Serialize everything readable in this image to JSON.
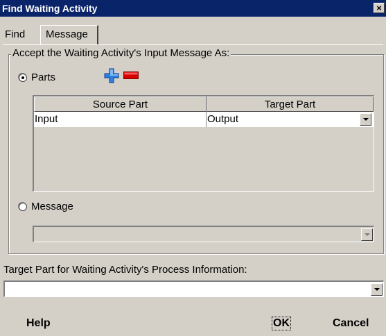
{
  "window": {
    "title": "Find Waiting Activity",
    "close_glyph": "×"
  },
  "tabs": [
    {
      "label": "Find",
      "active": false
    },
    {
      "label": "Message",
      "active": true
    }
  ],
  "accept_group": {
    "legend": "Accept the Waiting Activity's Input Message As:",
    "parts_option": {
      "label": "Parts",
      "selected": true
    },
    "message_option": {
      "label": "Message",
      "selected": false
    },
    "add_icon": "add-part-icon",
    "remove_icon": "remove-part-icon",
    "table": {
      "columns": [
        "Source Part",
        "Target Part"
      ],
      "rows": [
        {
          "source": "Input",
          "target": "Output"
        }
      ]
    },
    "message_combo_value": ""
  },
  "process_info": {
    "label": "Target Part for Waiting Activity's Process Information:",
    "value": ""
  },
  "buttons": {
    "help": "Help",
    "ok": "OK",
    "cancel": "Cancel"
  },
  "colors": {
    "titlebar": "#0a246a",
    "dialog_face": "#d4d0c8",
    "add_icon": "#2f7fe0",
    "remove_icon": "#d40000"
  }
}
